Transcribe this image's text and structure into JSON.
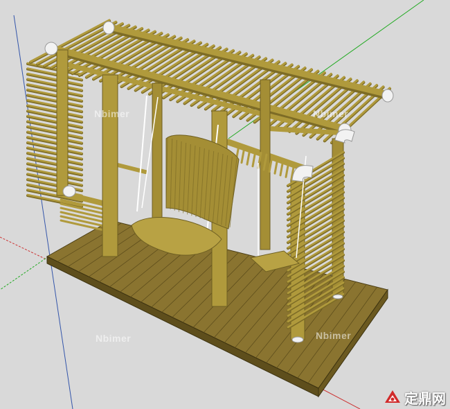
{
  "viewport": {
    "background": "#d9d9d9",
    "model": "bamboo pergola with swing chair and small swing seat on wooden deck"
  },
  "axes": {
    "green_axis_color": "#22aa22",
    "red_axis_color": "#cc3333",
    "blue_axis_color": "#3355aa"
  },
  "colors": {
    "bamboo": "#b09a3c",
    "bamboo_dark": "#7d6c26",
    "bamboo_light": "#cdb85a",
    "deck": "#8a7430",
    "deck_dark": "#5e4e1c",
    "connector": "#f2f2f2"
  },
  "watermarks": {
    "wm1": "Nbimer",
    "wm2": "Nbimer",
    "wm3": "Nbimer",
    "wm4": "Nbimer"
  },
  "brand": {
    "text": "定鼎网",
    "icon": "zhuding-logo-icon",
    "color": "#d12a2a"
  }
}
